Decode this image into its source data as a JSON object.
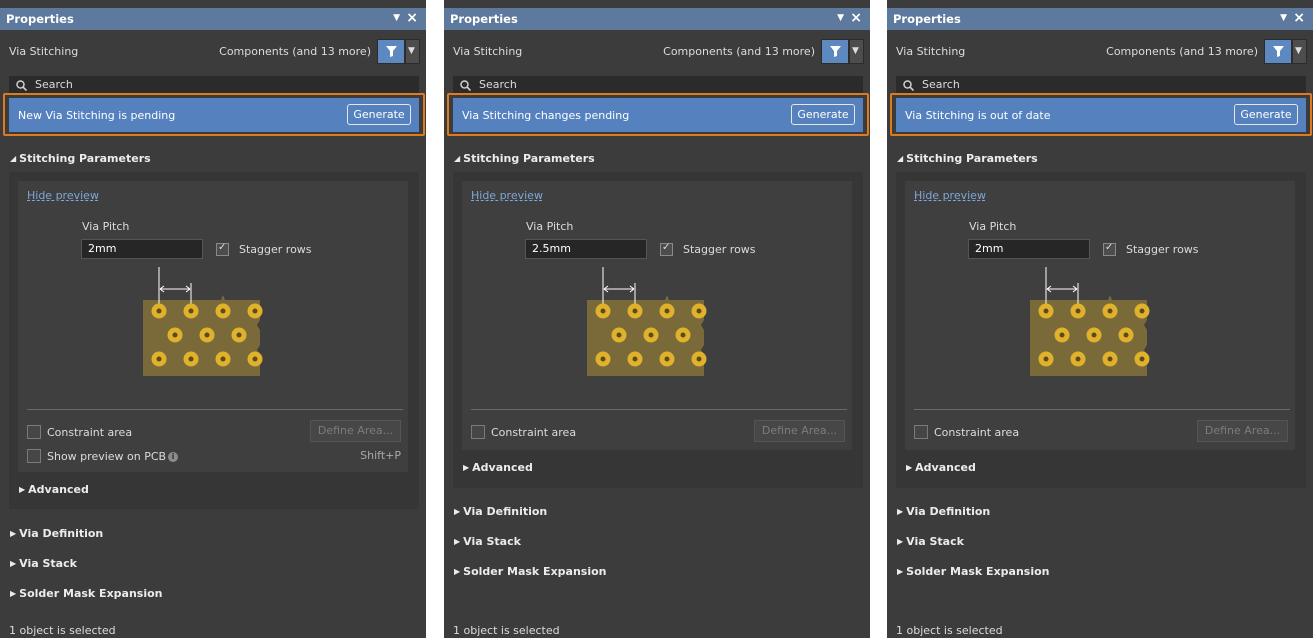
{
  "panels": [
    {
      "title": "Properties",
      "kind": "Via Stitching",
      "filter_text": "Components (and 13 more)",
      "search_placeholder": "Search",
      "banner_message": "New Via Stitching is pending",
      "generate_label": "Generate",
      "section_stitching": "Stitching Parameters",
      "hide_preview": "Hide preview",
      "via_pitch_label": "Via Pitch",
      "via_pitch_value": "2mm",
      "stagger_label": "Stagger rows",
      "stagger_checked": true,
      "constraint_label": "Constraint area",
      "define_area_label": "Define Area...",
      "show_preview_label": "Show preview on PCB",
      "shortcut": "Shift+P",
      "advanced": "Advanced",
      "via_definition": "Via Definition",
      "via_stack": "Via Stack",
      "solder_mask": "Solder Mask Expansion",
      "status": "1 object is selected"
    },
    {
      "title": "Properties",
      "kind": "Via Stitching",
      "filter_text": "Components (and 13 more)",
      "search_placeholder": "Search",
      "banner_message": "Via Stitching changes pending",
      "generate_label": "Generate",
      "section_stitching": "Stitching Parameters",
      "hide_preview": "Hide preview",
      "via_pitch_label": "Via Pitch",
      "via_pitch_value": "2.5mm",
      "stagger_label": "Stagger rows",
      "stagger_checked": true,
      "constraint_label": "Constraint area",
      "define_area_label": "Define Area...",
      "advanced": "Advanced",
      "via_definition": "Via Definition",
      "via_stack": "Via Stack",
      "solder_mask": "Solder Mask Expansion",
      "status": "1 object is selected"
    },
    {
      "title": "Properties",
      "kind": "Via Stitching",
      "filter_text": "Components (and 13 more)",
      "search_placeholder": "Search",
      "banner_message": "Via Stitching is out of date",
      "generate_label": "Generate",
      "section_stitching": "Stitching Parameters",
      "hide_preview": "Hide preview",
      "via_pitch_label": "Via Pitch",
      "via_pitch_value": "2mm",
      "stagger_label": "Stagger rows",
      "stagger_checked": true,
      "constraint_label": "Constraint area",
      "define_area_label": "Define Area...",
      "advanced": "Advanced",
      "via_definition": "Via Definition",
      "via_stack": "Via Stack",
      "solder_mask": "Solder Mask Expansion",
      "status": "1 object is selected"
    }
  ],
  "colors": {
    "panel_bg": "#3c3c3c",
    "titlebar": "#5d7a9e",
    "banner": "#5581bf",
    "highlight_outline": "#e07a1f",
    "copper_board": "#7a6a3a",
    "via_ring": "#e0b22c"
  },
  "icons": {
    "filter": "funnel-icon",
    "search": "magnifier-icon",
    "pin": "dropdown-arrow-icon",
    "close": "close-icon",
    "info": "info-icon",
    "expand": "triangle-right-icon",
    "collapse": "triangle-down-icon"
  }
}
